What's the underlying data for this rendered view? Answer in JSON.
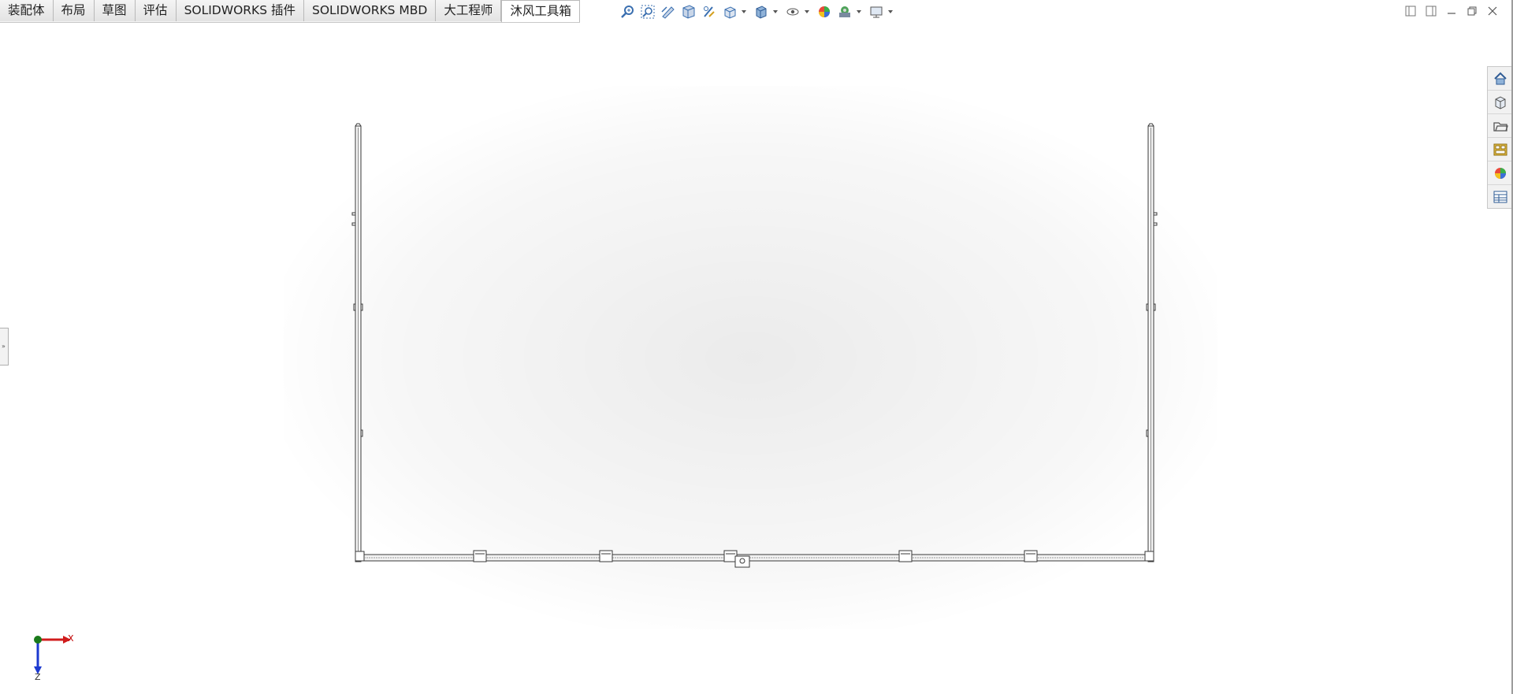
{
  "tabs": [
    {
      "label": "装配体",
      "active": false
    },
    {
      "label": "布局",
      "active": false
    },
    {
      "label": "草图",
      "active": false
    },
    {
      "label": "评估",
      "active": false
    },
    {
      "label": "SOLIDWORKS 插件",
      "active": false
    },
    {
      "label": "SOLIDWORKS MBD",
      "active": false
    },
    {
      "label": "大工程师",
      "active": false
    },
    {
      "label": "沐风工具箱",
      "active": true
    }
  ],
  "hud_toolbar": {
    "icons": [
      "zoom-to-fit-icon",
      "zoom-to-area-icon",
      "previous-view-icon",
      "section-view-icon",
      "dynamic-annotation-icon",
      "view-orientation-icon",
      "display-style-icon",
      "hide-show-items-icon",
      "edit-appearance-icon",
      "apply-scene-icon",
      "view-settings-icon"
    ]
  },
  "window_controls": [
    "tile-left-icon",
    "tile-right-icon",
    "minimize-icon",
    "restore-icon",
    "close-icon"
  ],
  "task_pane": [
    "solidworks-resources-icon",
    "design-library-icon",
    "file-explorer-icon",
    "view-palette-icon",
    "appearances-scenes-icon",
    "custom-properties-icon"
  ],
  "triad": {
    "x_label": "X",
    "z_label": "Z"
  },
  "left_handle_glyph": "»",
  "colors": {
    "model_line": "#3a3a3a",
    "axis_x": "#d01c1c",
    "axis_z": "#1c3ad0",
    "origin": "#1a7a1a"
  }
}
